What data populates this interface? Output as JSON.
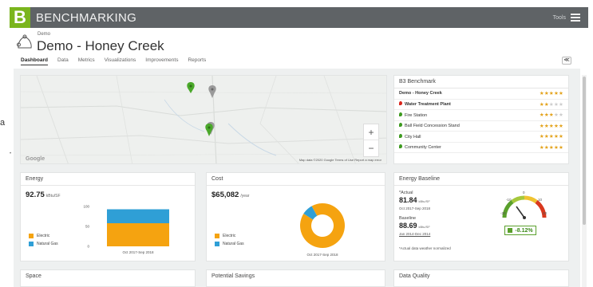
{
  "app": {
    "logo": "B",
    "name": "BENCHMARKING",
    "tools_label": "Tools"
  },
  "header": {
    "small_label": "Demo",
    "title": "Demo - Honey Creek",
    "icon": "building-icon"
  },
  "tabs": [
    {
      "label": "Dashboard",
      "active": true
    },
    {
      "label": "Data",
      "active": false
    },
    {
      "label": "Metrics",
      "active": false
    },
    {
      "label": "Visualizations",
      "active": false
    },
    {
      "label": "Improvements",
      "active": false
    },
    {
      "label": "Reports",
      "active": false
    }
  ],
  "side_text": "a",
  "map": {
    "footer": "Map data ©2020 Google   Terms of Use   Report a map error",
    "google": "Google",
    "zoom_in": "+",
    "zoom_out": "−"
  },
  "benchmark": {
    "title": "B3 Benchmark",
    "rows": [
      {
        "name": "Demo - Honey Creek",
        "stars": 5,
        "pin": "",
        "bold": true
      },
      {
        "name": "Water Treatment Plant",
        "stars": 2,
        "pin": "#d9261c",
        "bold": true
      },
      {
        "name": "Fire Station",
        "stars": 3,
        "pin": "#3d9a1f",
        "bold": false
      },
      {
        "name": "Ball Field Concession Stand",
        "stars": 5,
        "pin": "#3d9a1f",
        "bold": false
      },
      {
        "name": "City Hall",
        "stars": 5,
        "pin": "#3d9a1f",
        "bold": false
      },
      {
        "name": "Community Center",
        "stars": 5,
        "pin": "#3d9a1f",
        "bold": false
      }
    ]
  },
  "energy": {
    "title": "Energy",
    "value": "92.75",
    "unit": "kBtu/SF",
    "legend": [
      {
        "label": "Electric",
        "color": "#f5a310"
      },
      {
        "label": "Natural Gas",
        "color": "#2f9fd6"
      }
    ],
    "period": "Oct 2017-Sep 2018",
    "ticks": [
      "100",
      "50",
      "0"
    ]
  },
  "cost": {
    "title": "Cost",
    "value": "$65,082",
    "unit": "/year",
    "legend": [
      {
        "label": "Electric",
        "color": "#f5a310"
      },
      {
        "label": "Natural Gas",
        "color": "#2f9fd6"
      }
    ],
    "period": "Oct 2017-Sep 2018"
  },
  "baseline": {
    "title": "Energy Baseline",
    "actual_label": "*Actual",
    "actual_value": "81.84",
    "actual_unit": "kBtu/SF",
    "actual_period": "Oct 2017-Sep 2018",
    "baseline_label": "Baseline",
    "baseline_value": "88.69",
    "baseline_unit": "kBtu/SF",
    "baseline_period": "Jan 2014-Dec 2014",
    "note": "*Actual data weather normalized",
    "percent": "-8.12%",
    "gauge_ticks": [
      "-20",
      "-10",
      "0",
      "10",
      "20"
    ]
  },
  "bottom_cards": [
    "Space",
    "Potential Savings",
    "Data Quality"
  ],
  "chart_data": [
    {
      "type": "bar",
      "title": "Energy",
      "categories": [
        "Oct 2017-Sep 2018"
      ],
      "series": [
        {
          "name": "Electric",
          "values": [
            58
          ]
        },
        {
          "name": "Natural Gas",
          "values": [
            35
          ]
        }
      ],
      "stacked": true,
      "ylim": [
        0,
        100
      ],
      "yticks": [
        0,
        50,
        100
      ]
    },
    {
      "type": "pie",
      "title": "Cost",
      "donut": true,
      "categories": [
        "Electric",
        "Natural Gas"
      ],
      "values": [
        92,
        8
      ]
    }
  ]
}
